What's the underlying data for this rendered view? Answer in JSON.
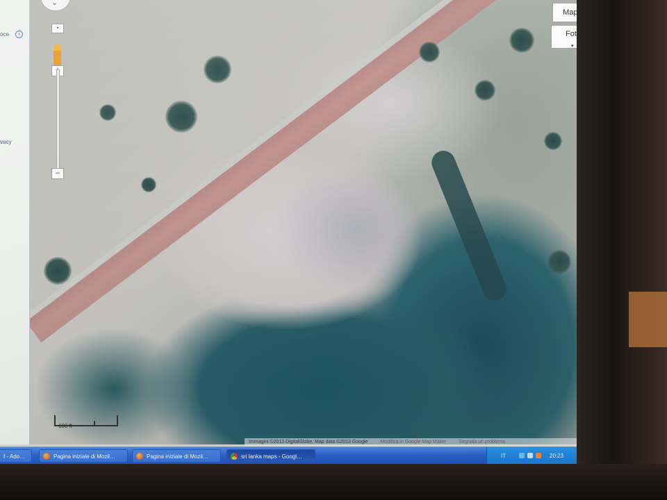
{
  "left_panel": {
    "top_fragment": "oce",
    "bottom_fragment": "vacy"
  },
  "map": {
    "map_type_buttons": {
      "map": "Mappa",
      "photo": "Foto"
    },
    "zoom": {
      "plus": "+",
      "minus": "–"
    },
    "scale_label": "100 ft",
    "attribution": {
      "imagery": "Immagini ©2013 DigitalGlobe, Map data ©2013 Google",
      "edit_link": "Modifica in Google Map Maker",
      "report_link": "Segnala un problema"
    }
  },
  "taskbar": {
    "tasks": [
      {
        "label": "f - Ado…",
        "icon": "app-icon"
      },
      {
        "label": "Pagina iniziale di Mozil…",
        "icon": "firefox-icon"
      },
      {
        "label": "Pagina iniziale di Mozil…",
        "icon": "firefox-icon"
      },
      {
        "label": "sri lanka maps - Googl…",
        "icon": "chrome-icon"
      }
    ],
    "tray": {
      "language": "IT",
      "clock": "20:23"
    }
  }
}
